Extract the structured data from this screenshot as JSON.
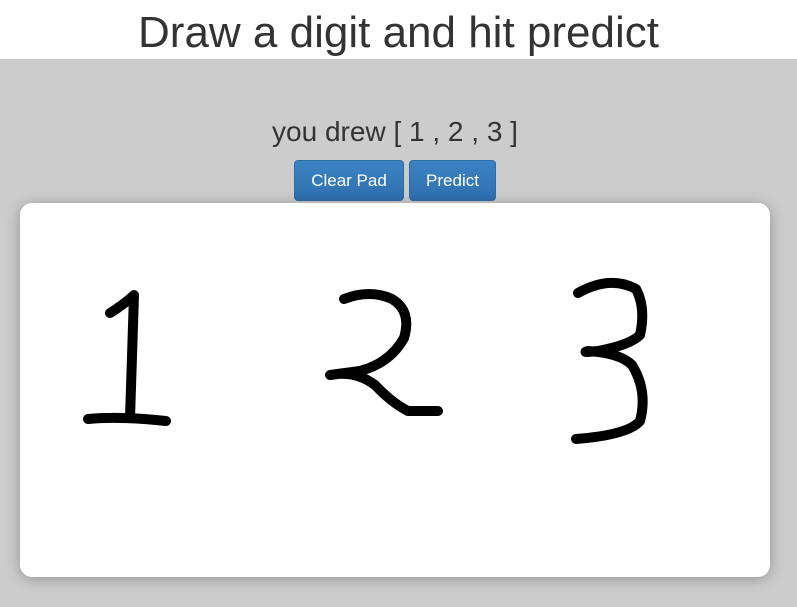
{
  "header": {
    "title": "Draw a digit and hit predict"
  },
  "result": {
    "text": "you drew [ 1 , 2 , 3 ]"
  },
  "toolbar": {
    "clear_label": "Clear Pad",
    "predict_label": "Predict"
  },
  "colors": {
    "background": "#cccccc",
    "header_background": "#ffffff",
    "pad_background": "#ffffff",
    "button": "#337ab7",
    "ink": "#000000"
  },
  "drawing_pad": {
    "drawn_digits": [
      "1",
      "2",
      "3"
    ]
  }
}
